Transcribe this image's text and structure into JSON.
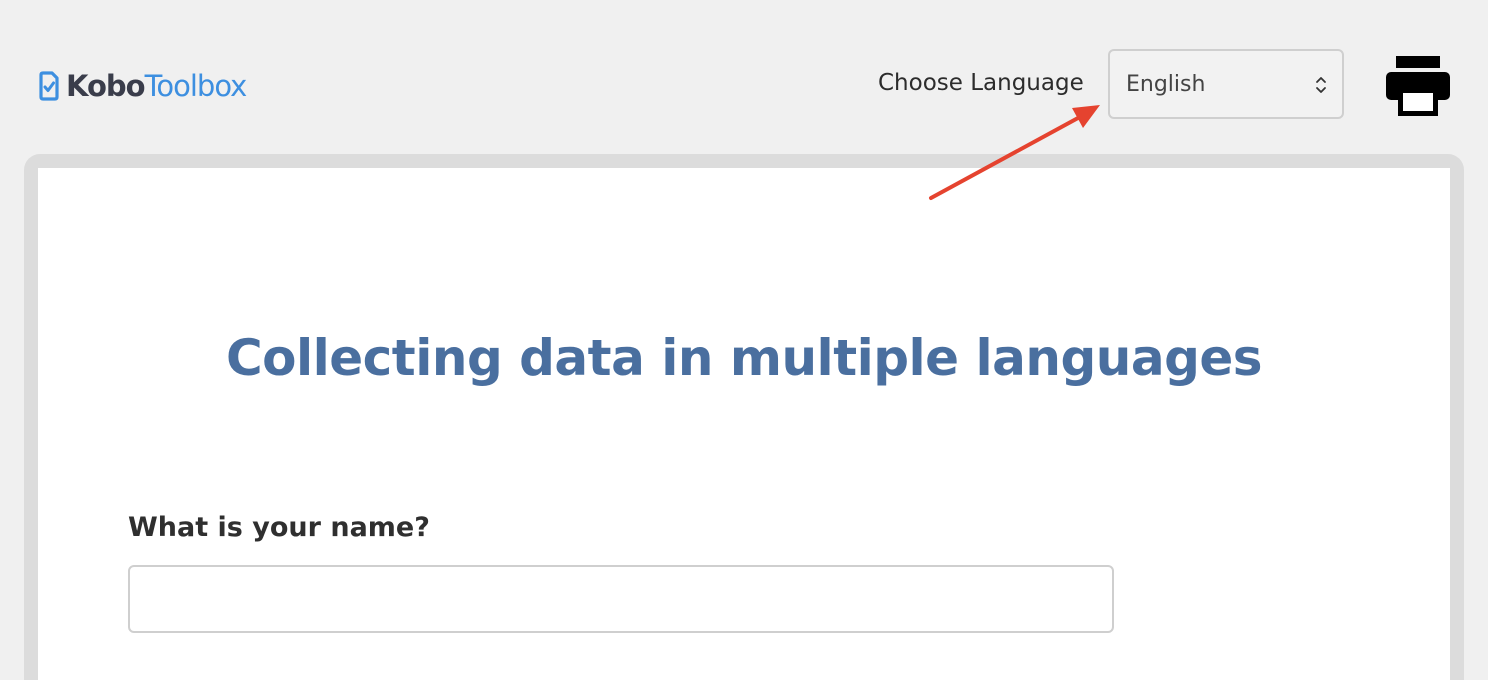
{
  "header": {
    "logo": {
      "kobo": "Kobo",
      "toolbox": "Toolbox"
    },
    "language_label": "Choose Language",
    "language_select": {
      "selected": "English"
    },
    "print_icon": "printer-icon"
  },
  "form": {
    "title": "Collecting data in multiple languages",
    "questions": [
      {
        "label": "What is your name?",
        "value": "",
        "placeholder": ""
      }
    ]
  },
  "annotation": {
    "arrow_color": "#e5432f"
  },
  "colors": {
    "background": "#f0f0f0",
    "title": "#4a6f9f",
    "logo_dark": "#3a3d4b",
    "logo_blue": "#3d8fe0"
  }
}
